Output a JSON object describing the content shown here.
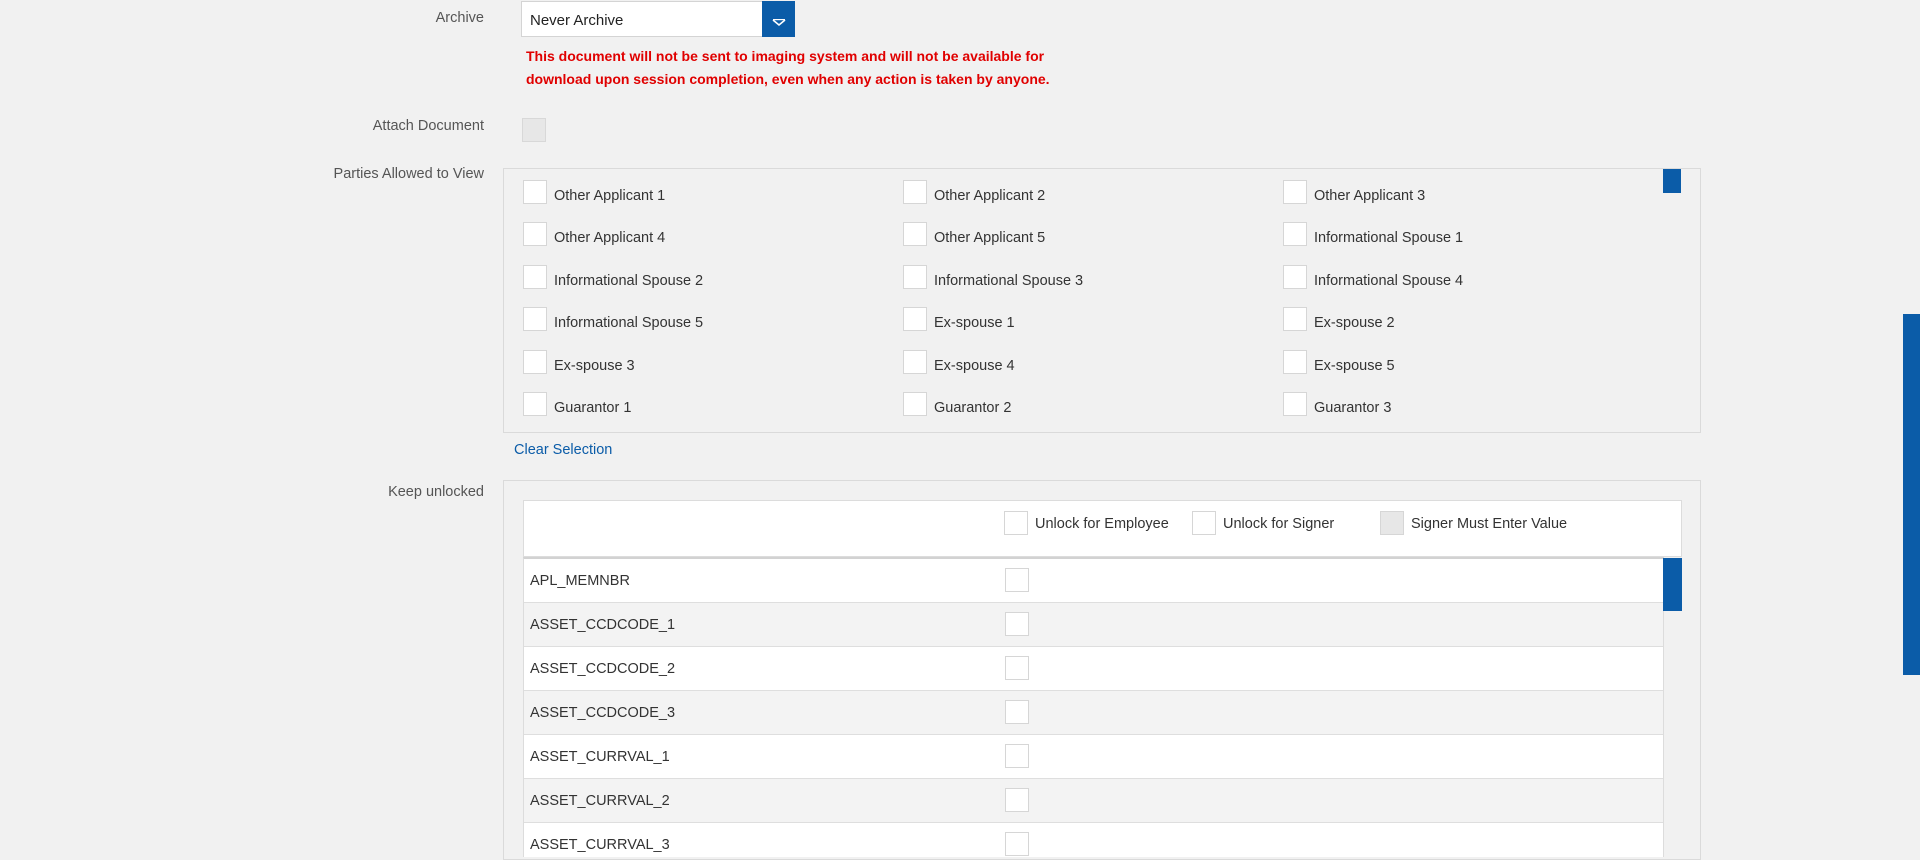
{
  "archive": {
    "label": "Archive",
    "selected": "Never Archive",
    "warning": "This document will not be sent to imaging system and will not be available for download upon session completion, even when any action is taken by anyone."
  },
  "attach": {
    "label": "Attach Document"
  },
  "parties": {
    "label": "Parties Allowed to View",
    "items": [
      "Other Applicant 1",
      "Other Applicant 2",
      "Other Applicant 3",
      "Other Applicant 4",
      "Other Applicant 5",
      "Informational Spouse 1",
      "Informational Spouse 2",
      "Informational Spouse 3",
      "Informational Spouse 4",
      "Informational Spouse 5",
      "Ex-spouse 1",
      "Ex-spouse 2",
      "Ex-spouse 3",
      "Ex-spouse 4",
      "Ex-spouse 5",
      "Guarantor 1",
      "Guarantor 2",
      "Guarantor 3"
    ],
    "clear_label": "Clear Selection"
  },
  "unlock": {
    "label": "Keep unlocked",
    "columns": {
      "employee": "Unlock for Employee",
      "signer": "Unlock for Signer",
      "must_enter": "Signer Must Enter Value"
    },
    "rows": [
      "APL_MEMNBR",
      "ASSET_CCDCODE_1",
      "ASSET_CCDCODE_2",
      "ASSET_CCDCODE_3",
      "ASSET_CURRVAL_1",
      "ASSET_CURRVAL_2",
      "ASSET_CURRVAL_3"
    ]
  },
  "colors": {
    "accent": "#0b5ca8",
    "warning": "#e00000",
    "link": "#0b5ca8"
  }
}
